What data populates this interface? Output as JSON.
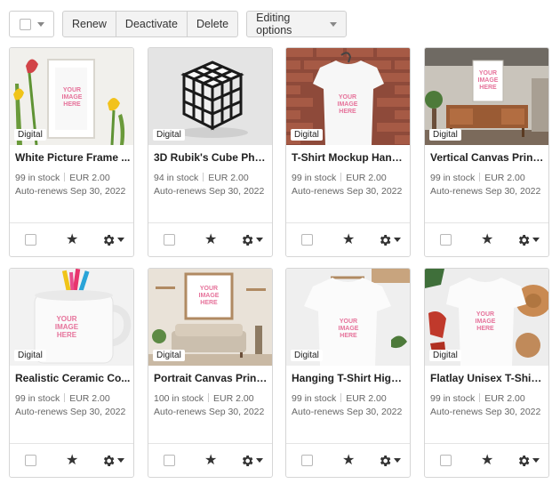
{
  "toolbar": {
    "renew_label": "Renew",
    "deactivate_label": "Deactivate",
    "delete_label": "Delete",
    "editing_options_label": "Editing options"
  },
  "placeholder": {
    "line1": "YOUR",
    "line2": "IMAGE",
    "line3": "HERE"
  },
  "listings": [
    {
      "badge": "Digital",
      "title": "White Picture Frame ...",
      "stock": "99 in stock",
      "price": "EUR 2.00",
      "renews": "Auto-renews Sep 30, 2022"
    },
    {
      "badge": "Digital",
      "title": "3D Rubik's Cube Phot...",
      "stock": "94 in stock",
      "price": "EUR 2.00",
      "renews": "Auto-renews Sep 30, 2022"
    },
    {
      "badge": "Digital",
      "title": "T-Shirt Mockup Hangi...",
      "stock": "99 in stock",
      "price": "EUR 2.00",
      "renews": "Auto-renews Sep 30, 2022"
    },
    {
      "badge": "Digital",
      "title": "Vertical Canvas Print ...",
      "stock": "99 in stock",
      "price": "EUR 2.00",
      "renews": "Auto-renews Sep 30, 2022"
    },
    {
      "badge": "Digital",
      "title": "Realistic Ceramic Co...",
      "stock": "99 in stock",
      "price": "EUR 2.00",
      "renews": "Auto-renews Sep 30, 2022"
    },
    {
      "badge": "Digital",
      "title": "Portrait Canvas Print ...",
      "stock": "100 in stock",
      "price": "EUR 2.00",
      "renews": "Auto-renews Sep 30, 2022"
    },
    {
      "badge": "Digital",
      "title": "Hanging T-Shirt High ...",
      "stock": "99 in stock",
      "price": "EUR 2.00",
      "renews": "Auto-renews Sep 30, 2022"
    },
    {
      "badge": "Digital",
      "title": "Flatlay Unisex T-Shirt ...",
      "stock": "99 in stock",
      "price": "EUR 2.00",
      "renews": "Auto-renews Sep 30, 2022"
    }
  ]
}
